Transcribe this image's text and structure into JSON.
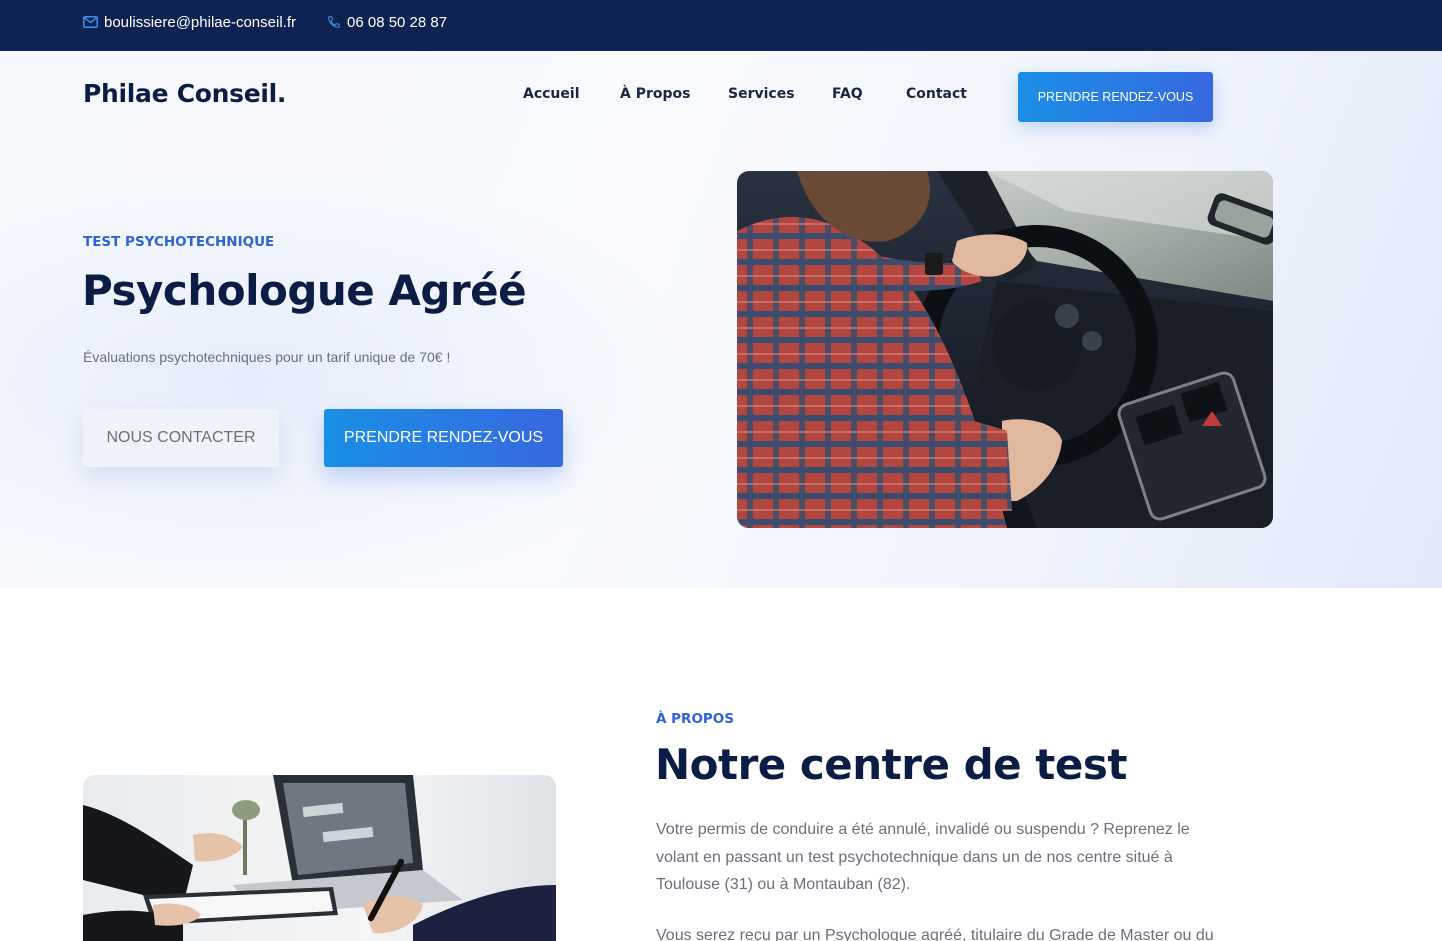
{
  "topbar": {
    "email": "boulissiere@philae-conseil.fr",
    "phone": "06 08 50 28 87"
  },
  "header": {
    "logo": "Philae Conseil.",
    "nav": [
      "Accueil",
      "À Propos",
      "Services",
      "FAQ",
      "Contact"
    ],
    "cta": "PRENDRE RENDEZ-VOUS"
  },
  "hero": {
    "kicker": "TEST PSYCHOTECHNIQUE",
    "title": "Psychologue Agréé",
    "subtitle": "Évaluations psychotechniques pour un tarif unique de 70€ !",
    "btn_contact": "NOUS CONTACTER",
    "btn_rdv": "PRENDRE RENDEZ-VOUS"
  },
  "about": {
    "kicker": "À PROPOS",
    "title": "Notre centre de test",
    "p1": "Votre permis de conduire a été annulé, invalidé ou suspendu ? Reprenez le volant en passant un test psychotechnique dans un de nos centre situé à Toulouse (31) ou à Montauban (82).",
    "p2": "Vous serez reçu par un Psychologue agréé, titulaire du Grade de Master ou du"
  },
  "colors": {
    "navy": "#0f2352",
    "accent": "#2f62d6",
    "button_gradient_start": "#1a8fe6",
    "button_gradient_end": "#3768e0"
  },
  "icons": {
    "email": "envelope-icon",
    "phone": "phone-icon"
  }
}
